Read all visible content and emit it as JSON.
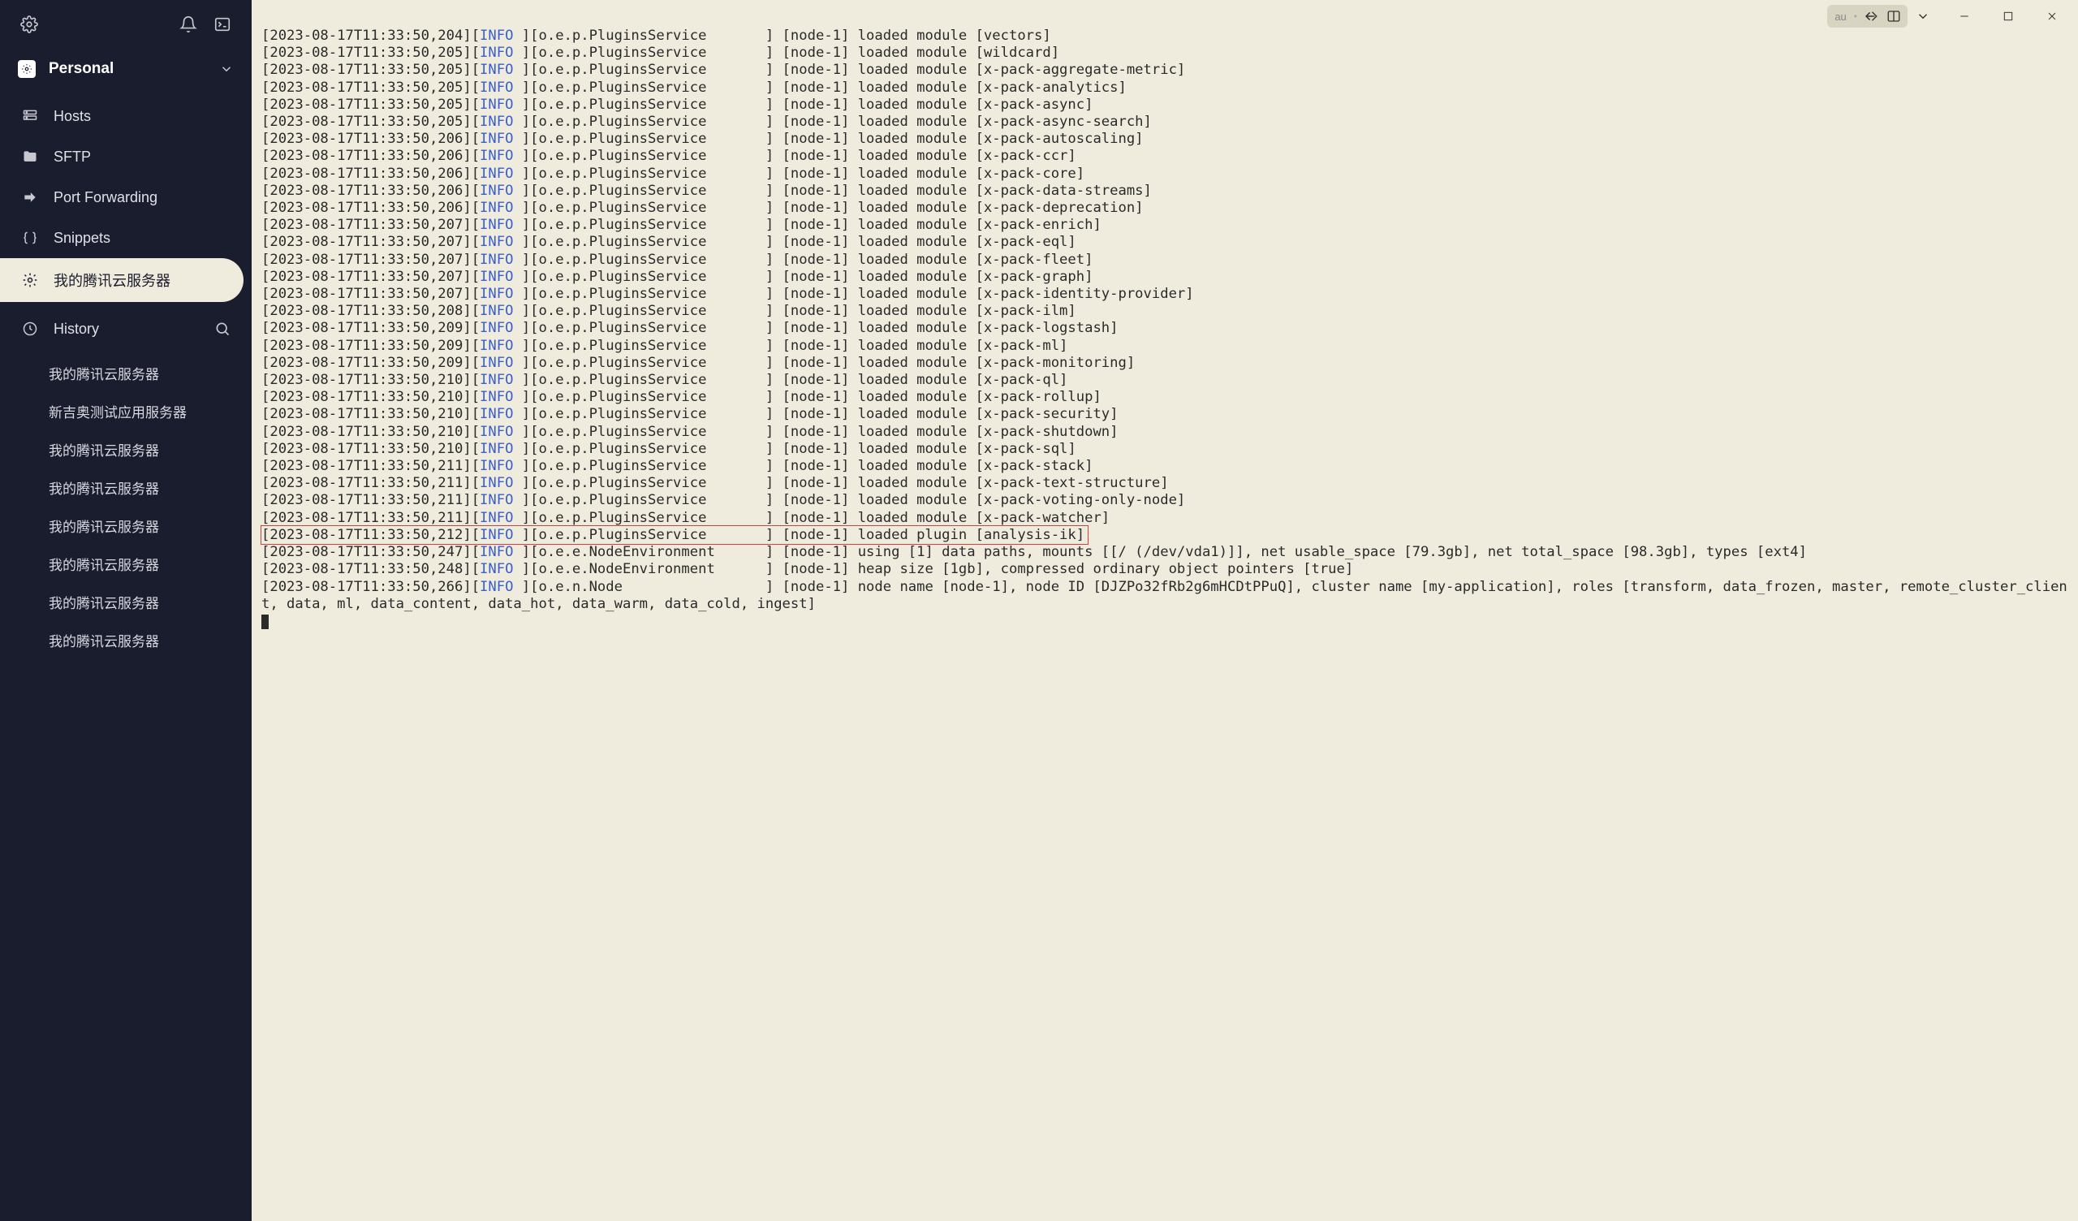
{
  "sidebar": {
    "personal_label": "Personal",
    "nav": [
      {
        "icon": "hosts",
        "label": "Hosts"
      },
      {
        "icon": "folder",
        "label": "SFTP"
      },
      {
        "icon": "forward",
        "label": "Port Forwarding"
      },
      {
        "icon": "braces",
        "label": "Snippets"
      },
      {
        "icon": "settings-small",
        "label": "我的腾讯云服务器",
        "active": true
      }
    ],
    "history_label": "History",
    "history": [
      "我的腾讯云服务器",
      "新吉奥测试应用服务器",
      "我的腾讯云服务器",
      "我的腾讯云服务器",
      "我的腾讯云服务器",
      "我的腾讯云服务器",
      "我的腾讯云服务器",
      "我的腾讯云服务器"
    ]
  },
  "titlebar": {
    "hint": "au"
  },
  "log": {
    "level": "INFO",
    "logger_plugins": "o.e.p.PluginsService",
    "logger_nodeenv": "o.e.e.NodeEnvironment",
    "logger_node": "o.e.n.Node",
    "node": "node-1",
    "entries": [
      {
        "ts": "2023-08-17T11:33:50,204",
        "msg": "loaded module [vectors]"
      },
      {
        "ts": "2023-08-17T11:33:50,205",
        "msg": "loaded module [wildcard]"
      },
      {
        "ts": "2023-08-17T11:33:50,205",
        "msg": "loaded module [x-pack-aggregate-metric]"
      },
      {
        "ts": "2023-08-17T11:33:50,205",
        "msg": "loaded module [x-pack-analytics]"
      },
      {
        "ts": "2023-08-17T11:33:50,205",
        "msg": "loaded module [x-pack-async]"
      },
      {
        "ts": "2023-08-17T11:33:50,205",
        "msg": "loaded module [x-pack-async-search]"
      },
      {
        "ts": "2023-08-17T11:33:50,206",
        "msg": "loaded module [x-pack-autoscaling]"
      },
      {
        "ts": "2023-08-17T11:33:50,206",
        "msg": "loaded module [x-pack-ccr]"
      },
      {
        "ts": "2023-08-17T11:33:50,206",
        "msg": "loaded module [x-pack-core]"
      },
      {
        "ts": "2023-08-17T11:33:50,206",
        "msg": "loaded module [x-pack-data-streams]"
      },
      {
        "ts": "2023-08-17T11:33:50,206",
        "msg": "loaded module [x-pack-deprecation]"
      },
      {
        "ts": "2023-08-17T11:33:50,207",
        "msg": "loaded module [x-pack-enrich]"
      },
      {
        "ts": "2023-08-17T11:33:50,207",
        "msg": "loaded module [x-pack-eql]"
      },
      {
        "ts": "2023-08-17T11:33:50,207",
        "msg": "loaded module [x-pack-fleet]"
      },
      {
        "ts": "2023-08-17T11:33:50,207",
        "msg": "loaded module [x-pack-graph]"
      },
      {
        "ts": "2023-08-17T11:33:50,207",
        "msg": "loaded module [x-pack-identity-provider]"
      },
      {
        "ts": "2023-08-17T11:33:50,208",
        "msg": "loaded module [x-pack-ilm]"
      },
      {
        "ts": "2023-08-17T11:33:50,209",
        "msg": "loaded module [x-pack-logstash]"
      },
      {
        "ts": "2023-08-17T11:33:50,209",
        "msg": "loaded module [x-pack-ml]"
      },
      {
        "ts": "2023-08-17T11:33:50,209",
        "msg": "loaded module [x-pack-monitoring]"
      },
      {
        "ts": "2023-08-17T11:33:50,210",
        "msg": "loaded module [x-pack-ql]"
      },
      {
        "ts": "2023-08-17T11:33:50,210",
        "msg": "loaded module [x-pack-rollup]"
      },
      {
        "ts": "2023-08-17T11:33:50,210",
        "msg": "loaded module [x-pack-security]"
      },
      {
        "ts": "2023-08-17T11:33:50,210",
        "msg": "loaded module [x-pack-shutdown]"
      },
      {
        "ts": "2023-08-17T11:33:50,210",
        "msg": "loaded module [x-pack-sql]"
      },
      {
        "ts": "2023-08-17T11:33:50,211",
        "msg": "loaded module [x-pack-stack]"
      },
      {
        "ts": "2023-08-17T11:33:50,211",
        "msg": "loaded module [x-pack-text-structure]"
      },
      {
        "ts": "2023-08-17T11:33:50,211",
        "msg": "loaded module [x-pack-voting-only-node]"
      },
      {
        "ts": "2023-08-17T11:33:50,211",
        "msg": "loaded module [x-pack-watcher]"
      },
      {
        "ts": "2023-08-17T11:33:50,212",
        "msg": "loaded plugin [analysis-ik]",
        "highlight": true
      }
    ],
    "tail": [
      {
        "ts": "2023-08-17T11:33:50,247",
        "logger": "o.e.e.NodeEnvironment",
        "body": "using [1] data paths, mounts [[/ (/dev/vda1)]], net usable_space [79.3gb], net total_space [98.3gb], types [ext4]"
      },
      {
        "ts": "2023-08-17T11:33:50,248",
        "logger": "o.e.e.NodeEnvironment",
        "body": "heap size [1gb], compressed ordinary object pointers [true]"
      },
      {
        "ts": "2023-08-17T11:33:50,266",
        "logger": "o.e.n.Node",
        "body": "node name [node-1], node ID [DJZPo32fRb2g6mHCDtPPuQ], cluster name [my-application], roles [transform, data_frozen, master, remote_cluster_client, data, ml, data_content, data_hot, data_warm, data_cold, ingest]"
      }
    ]
  }
}
